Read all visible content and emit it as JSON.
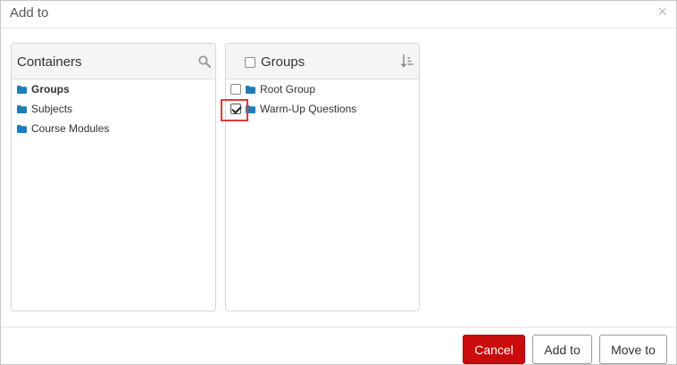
{
  "dialog": {
    "title": "Add to",
    "close_symbol": "×"
  },
  "containers": {
    "title": "Containers",
    "search_icon": "search-icon",
    "items": [
      {
        "label": "Groups",
        "selected": true,
        "icon": "folder-icon"
      },
      {
        "label": "Subjects",
        "selected": false,
        "icon": "folder-icon"
      },
      {
        "label": "Course Modules",
        "selected": false,
        "icon": "folder-icon"
      }
    ]
  },
  "groups": {
    "title": "Groups",
    "sort_icon": "sort-icon",
    "select_all_checked": false,
    "items": [
      {
        "label": "Root Group",
        "checked": false,
        "icon": "folder-icon"
      },
      {
        "label": "Warm-Up Questions",
        "checked": true,
        "icon": "folder-icon"
      }
    ]
  },
  "footer": {
    "cancel_label": "Cancel",
    "add_label": "Add to",
    "move_label": "Move to"
  },
  "colors": {
    "folder": "#1d7db7",
    "cancel_bg": "#c90b0b",
    "highlight": "#e03a3a"
  }
}
